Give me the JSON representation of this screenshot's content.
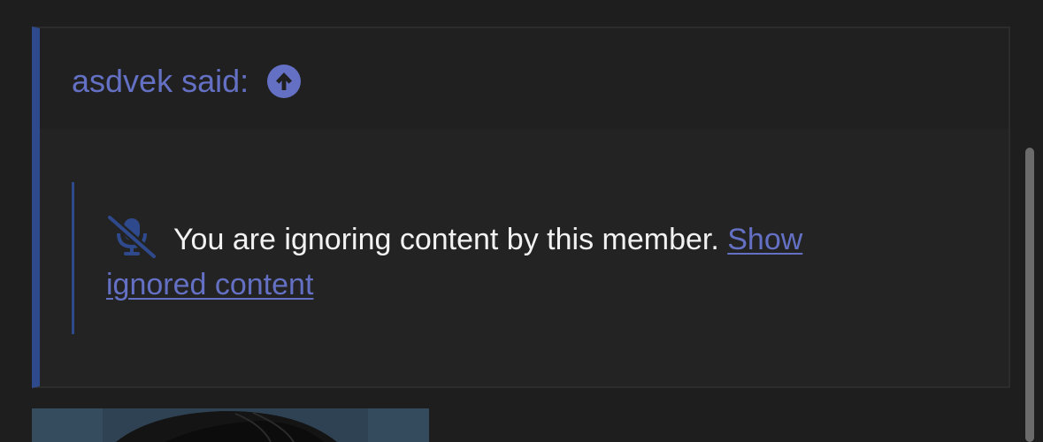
{
  "quote": {
    "author_label": "asdvek said:",
    "jump_icon": "arrow-circle-up-icon",
    "ignored_icon": "microphone-slash-icon",
    "ignored_message": "You are ignoring content by this member.",
    "show_link_part1": "Show",
    "show_link_part2": "ignored content"
  },
  "attachment": {
    "type": "image"
  },
  "colors": {
    "background": "#1e1e1e",
    "quote_background": "#232323",
    "quote_header_background": "#202020",
    "quote_border_accent": "#2f4a8c",
    "link": "#6470c4",
    "text": "#f2f2f2"
  }
}
